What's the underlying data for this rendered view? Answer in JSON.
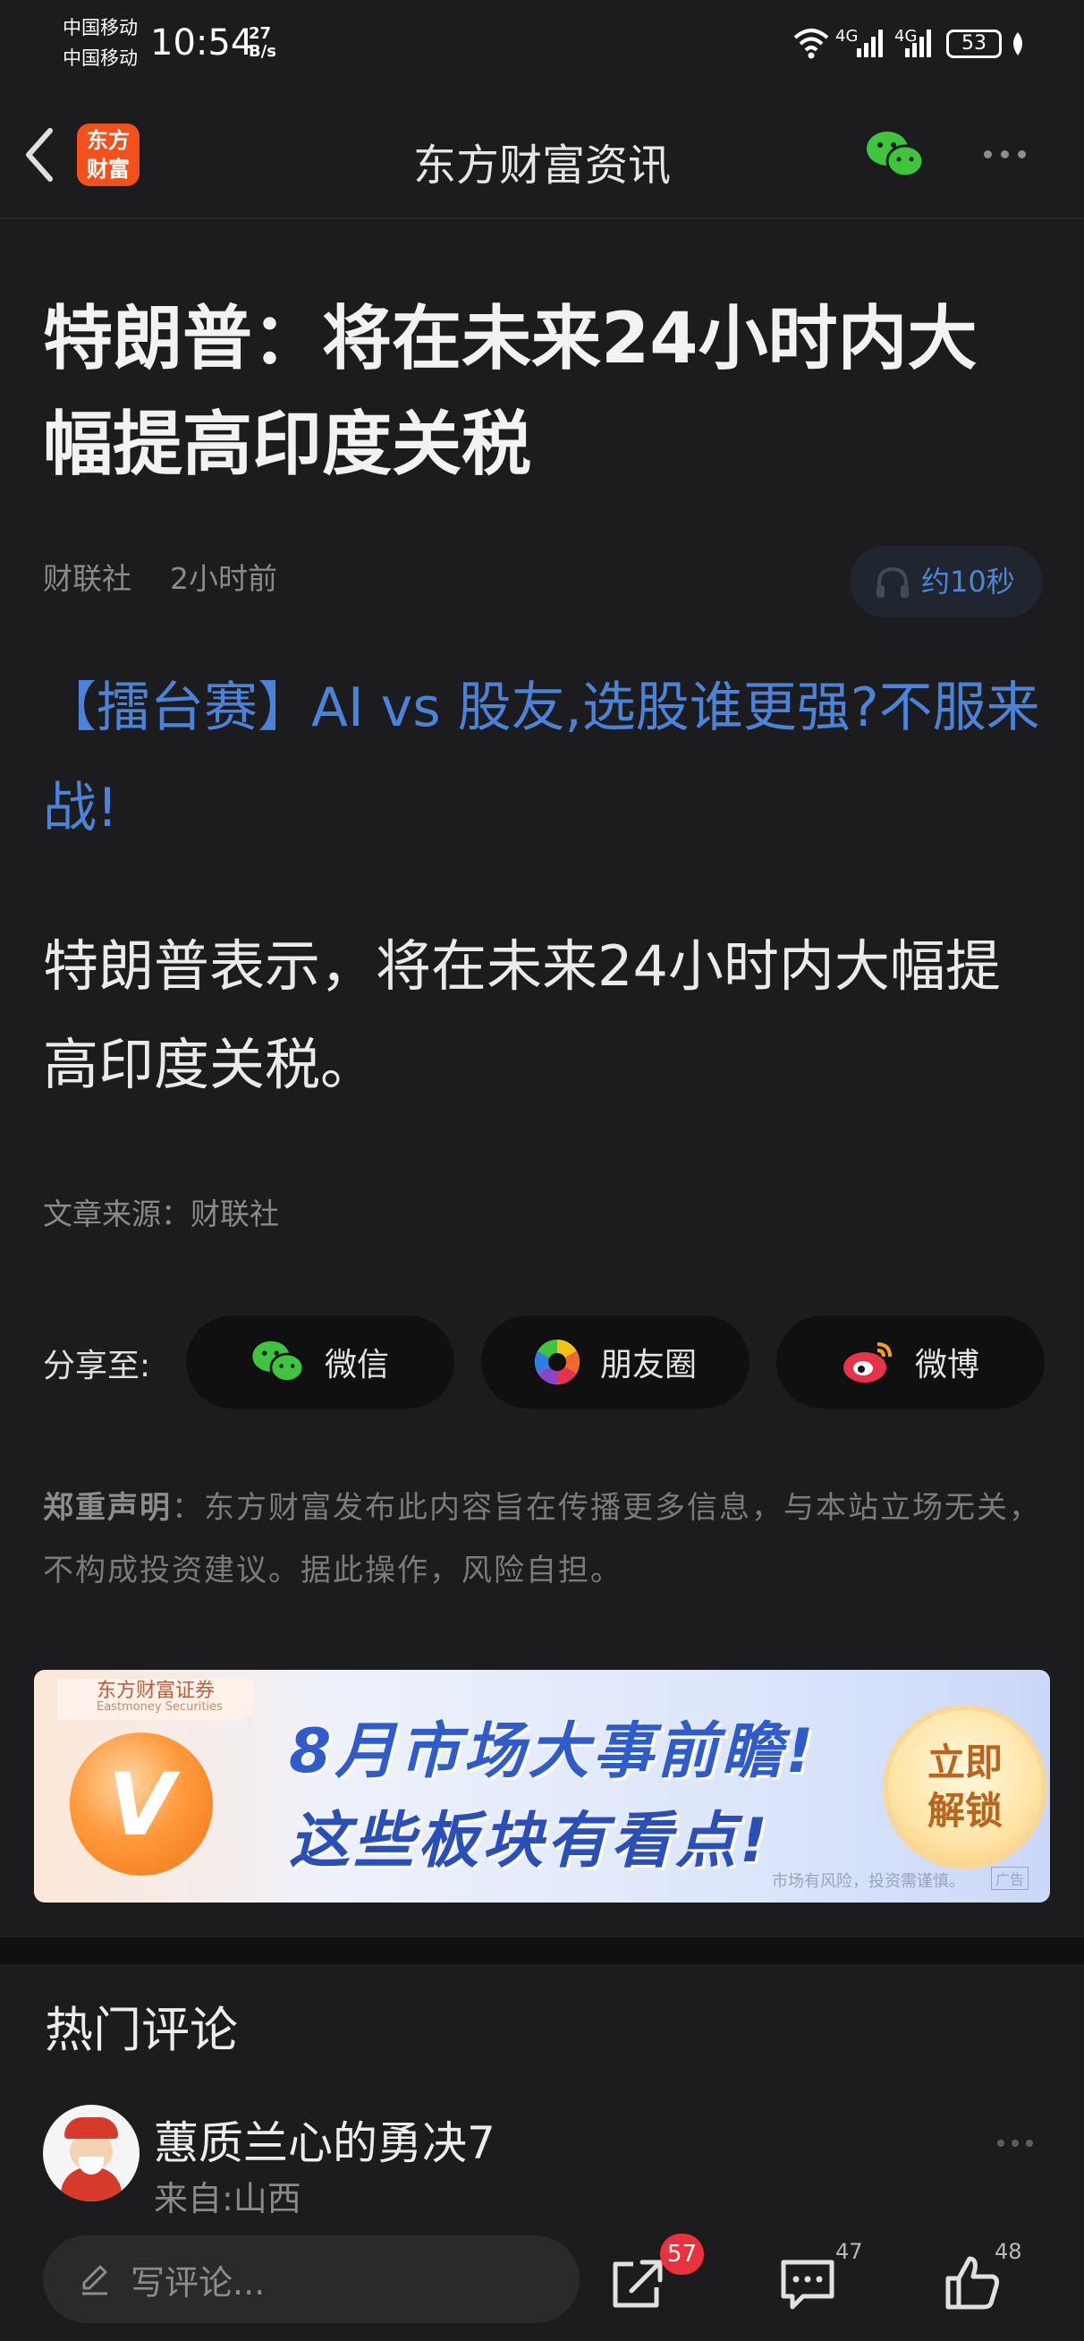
{
  "status_bar": {
    "carrier_1": "中国移动",
    "carrier_2": "中国移动",
    "time": "10:54",
    "net_speed_value": "27",
    "net_speed_unit": "B/s",
    "signal_1": "4G",
    "signal_2": "4G",
    "battery": "53"
  },
  "nav": {
    "title": "东方财富资讯",
    "logo_line1": "东方",
    "logo_line2": "财富"
  },
  "article": {
    "headline": "特朗普：将在未来24小时内大幅提高印度关税",
    "source_name": "财联社",
    "time_ago": "2小时前",
    "listen_label": "约10秒",
    "promo_link": "【擂台赛】AI vs 股友,选股谁更强?不服来战!",
    "body": "特朗普表示，将在未来24小时内大幅提高印度关税。",
    "source_line": "文章来源：财联社"
  },
  "share": {
    "label": "分享至:",
    "wechat": "微信",
    "moments": "朋友圈",
    "weibo": "微博"
  },
  "disclaimer": {
    "bold": "郑重声明",
    "text": "：东方财富发布此内容旨在传播更多信息，与本站立场无关，不构成投资建议。据此操作，风险自担。"
  },
  "banner": {
    "brand": "东方财富证券",
    "brand_en": "Eastmoney Securities",
    "coin_letter": "V",
    "line1": "8月市场大事前瞻!",
    "line2": "这些板块有看点!",
    "cta_line1": "立即",
    "cta_line2": "解锁",
    "risk_note": "市场有风险，投资需谨慎。",
    "ad_tag": "广告"
  },
  "comments": {
    "section_title": "热门评论",
    "items": [
      {
        "name": "蕙质兰心的勇决7",
        "from": "来自:山西"
      }
    ]
  },
  "bottom_bar": {
    "input_placeholder": "写评论...",
    "share_badge": "57",
    "comment_count": "47",
    "like_count": "48"
  },
  "colors": {
    "background": "#1c1c1e",
    "link_blue": "#4a83d8",
    "brand_orange": "#f2511b",
    "badge_red": "#e8323e",
    "wechat_green": "#3ec53d"
  },
  "icons": [
    "back-arrow-icon",
    "wechat-icon",
    "more-dots-icon",
    "headphone-icon",
    "moments-icon",
    "weibo-icon",
    "pencil-icon",
    "share-out-icon",
    "comment-icon",
    "thumbs-up-icon"
  ]
}
